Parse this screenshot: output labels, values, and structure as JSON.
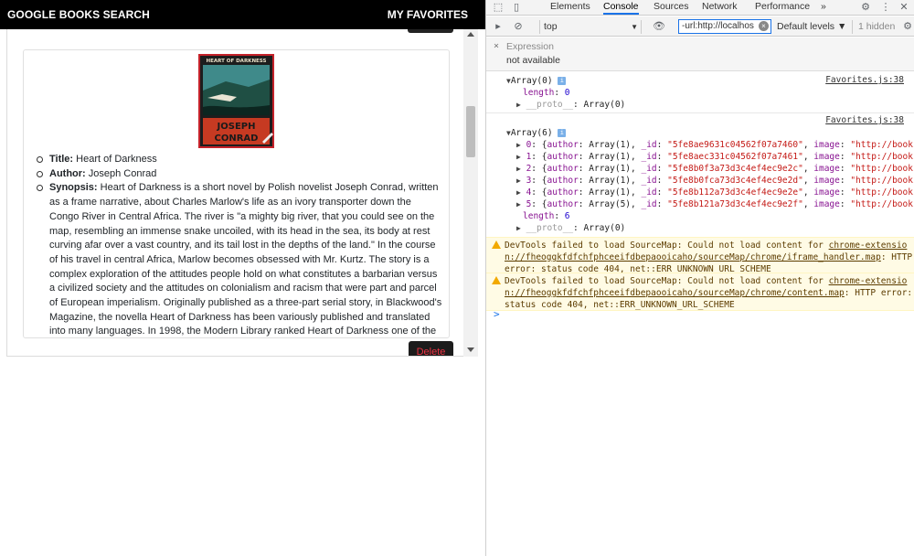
{
  "navbar": {
    "brand": "GOOGLE BOOKS SEARCH",
    "favorites": "MY FAVORITES"
  },
  "book": {
    "cover_alt": "Heart of Darkness",
    "cover_title": "HEART OF DARKNESS",
    "cover_author_line1": "JOSEPH",
    "cover_author_line2": "CONRAD",
    "title_label": "Title:",
    "title": "Heart of Darkness",
    "author_label": "Author:",
    "author": "Joseph Conrad",
    "synopsis_label": "Synopsis:",
    "synopsis": "Heart of Darkness is a short novel by Polish novelist Joseph Conrad, written as a frame narrative, about Charles Marlow's life as an ivory transporter down the Congo River in Central Africa. The river is \"a mighty big river, that you could see on the map, resembling an immense snake uncoiled, with its head in the sea, its body at rest curving afar over a vast country, and its tail lost in the depths of the land.\" In the course of his travel in central Africa, Marlow becomes obsessed with Mr. Kurtz. The story is a complex exploration of the attitudes people hold on what constitutes a barbarian versus a civilized society and the attitudes on colonialism and racism that were part and parcel of European imperialism. Originally published as a three-part serial story, in Blackwood's Magazine, the novella Heart of Darkness has been variously published and translated into many languages. In 1998, the Modern Library ranked Heart of Darkness one of the hundred best novels in English of the twentieth century.",
    "delete_label": "Delete"
  },
  "devtools": {
    "tabs": [
      "Elements",
      "Console",
      "Sources",
      "Network",
      "Performance"
    ],
    "more_tabs": "»",
    "context": "top",
    "filter_value": "-url:http://localhos",
    "levels": "Default levels ▼",
    "hidden": "1 hidden",
    "expression_label": "Expression",
    "expression_value": "not available"
  },
  "console": {
    "source": "Favorites.js:38",
    "arr0_head": "Array(0)",
    "arr0_length_key": "length",
    "arr0_length": "0",
    "proto_key": "__proto__",
    "proto_val": "Array(0)",
    "arr6_head": "Array(6)",
    "rows": [
      {
        "idx": "0",
        "authors": "Array(1)",
        "id": "\"5fe8ae9631c04562f07a7460\"",
        "image": "\"http://books…"
      },
      {
        "idx": "1",
        "authors": "Array(1)",
        "id": "\"5fe8aec331c04562f07a7461\"",
        "image": "\"http://books…"
      },
      {
        "idx": "2",
        "authors": "Array(1)",
        "id": "\"5fe8b0f3a73d3c4ef4ec9e2c\"",
        "image": "\"http://books…"
      },
      {
        "idx": "3",
        "authors": "Array(1)",
        "id": "\"5fe8b0fca73d3c4ef4ec9e2d\"",
        "image": "\"http://books…"
      },
      {
        "idx": "4",
        "authors": "Array(1)",
        "id": "\"5fe8b112a73d3c4ef4ec9e2e\"",
        "image": "\"http://books…"
      },
      {
        "idx": "5",
        "authors": "Array(5)",
        "id": "\"5fe8b121a73d3c4ef4ec9e2f\"",
        "image": "\"http://books…"
      }
    ],
    "arr6_length": "6",
    "warnings": [
      {
        "line1_prefix": "DevTools failed to load SourceMap: Could not load content for ",
        "line1_link": "chrome-extensio",
        "line2_link": "n://fheoggkfdfchfphceeifdbepaooicaho/sourceMap/chrome/iframe_handler.map",
        "line2_suffix": ": HTTP",
        "line3": "error: status code 404, net::ERR_UNKNOWN_URL_SCHEME"
      },
      {
        "line1_prefix": "DevTools failed to load SourceMap: Could not load content for ",
        "line1_link": "chrome-extensio",
        "line2_link": "n://fheoggkfdfchfphceeifdbepaooicaho/sourceMap/chrome/content.map",
        "line2_suffix": ": HTTP error:",
        "line3": "status code 404, net::ERR_UNKNOWN_URL_SCHEME"
      }
    ],
    "prompt": ">"
  }
}
